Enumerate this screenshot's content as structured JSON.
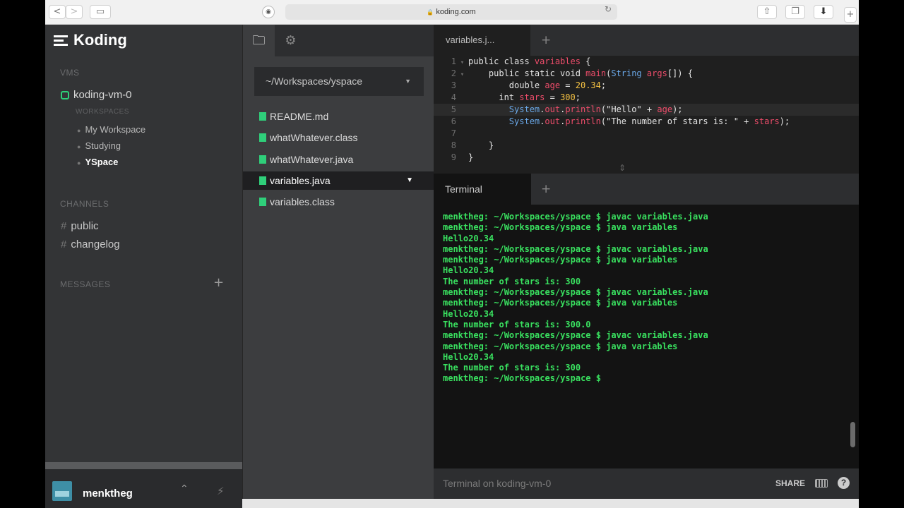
{
  "browser": {
    "url": "koding.com",
    "back": "<",
    "forward": ">"
  },
  "app": {
    "name": "Koding"
  },
  "sidebar": {
    "vms_header": "VMS",
    "vm_name": "koding-vm-0",
    "workspaces_header": "WORKSPACES",
    "workspaces": [
      {
        "label": "My Workspace"
      },
      {
        "label": "Studying"
      },
      {
        "label": "YSpace"
      }
    ],
    "channels_header": "CHANNELS",
    "channels": [
      {
        "label": "public"
      },
      {
        "label": "changelog"
      }
    ],
    "messages_header": "MESSAGES",
    "add_label": "+",
    "username": "menktheg"
  },
  "files": {
    "path": "~/Workspaces/yspace",
    "items": [
      {
        "name": "README.md"
      },
      {
        "name": "whatWhatever.class"
      },
      {
        "name": "whatWhatever.java"
      },
      {
        "name": "variables.java"
      },
      {
        "name": "variables.class"
      }
    ]
  },
  "editor": {
    "tab_label": "variables.j...",
    "add_label": "+",
    "line_numbers": [
      "1",
      "2",
      "3",
      "4",
      "5",
      "6",
      "7",
      "8",
      "9"
    ]
  },
  "terminal": {
    "tab_label": "Terminal",
    "add_label": "+",
    "lines": [
      "menktheg: ~/Workspaces/yspace $ javac variables.java",
      "menktheg: ~/Workspaces/yspace $ java variables",
      "Hello20.34",
      "menktheg: ~/Workspaces/yspace $ javac variables.java",
      "menktheg: ~/Workspaces/yspace $ java variables",
      "Hello20.34",
      "The number of stars is: 300",
      "menktheg: ~/Workspaces/yspace $ javac variables.java",
      "menktheg: ~/Workspaces/yspace $ java variables",
      "Hello20.34",
      "The number of stars is: 300.0",
      "menktheg: ~/Workspaces/yspace $ javac variables.java",
      "menktheg: ~/Workspaces/yspace $ java variables",
      "Hello20.34",
      "The number of stars is: 300",
      "menktheg: ~/Workspaces/yspace $"
    ],
    "status_label": "Terminal on koding-vm-0",
    "share_label": "SHARE",
    "help_label": "?"
  },
  "colors": {
    "accent_green": "#2fcf7a",
    "terminal_green": "#39e05f",
    "code_variable": "#ef4d6b",
    "code_number": "#f6c343",
    "code_type": "#6aa8e8"
  }
}
